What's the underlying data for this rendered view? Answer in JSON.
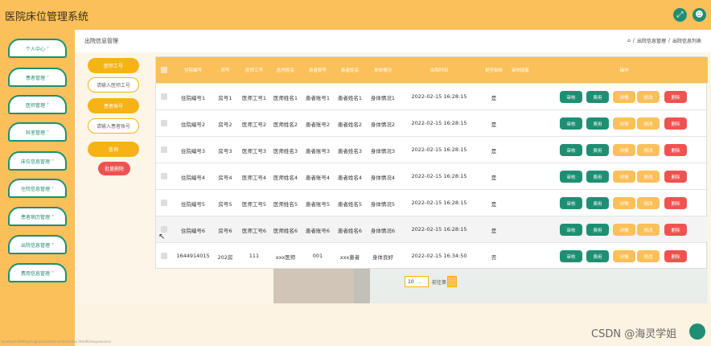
{
  "app": {
    "title": "医院床位管理系统",
    "icons": [
      "expand-icon",
      "user-icon"
    ]
  },
  "sidebar": {
    "items": [
      {
        "label": "个人中心 ˅"
      },
      {
        "label": "患者管理 ˅"
      },
      {
        "label": "医师管理 ˅"
      },
      {
        "label": "科室管理 ˅"
      },
      {
        "label": "床位信息管理 ˅"
      },
      {
        "label": "住院信息管理 ˅"
      },
      {
        "label": "患者病历管理 ˅"
      },
      {
        "label": "出院信息管理 ˅"
      },
      {
        "label": "费用信息管理 ˅"
      }
    ]
  },
  "header": {
    "page_title": "出院信息管理",
    "breadcrumb": [
      "⌂",
      "/",
      "出院信息管理",
      "/",
      "出院信息列表"
    ]
  },
  "search": {
    "doctor_label": "医师工号",
    "doctor_placeholder": "请输入医师工号",
    "patient_label": "患者账号",
    "patient_placeholder": "请输入患者账号",
    "query_button": "查询",
    "batch_delete_button": "批量删除"
  },
  "table": {
    "columns": [
      "住院编号",
      "房号",
      "医师工号",
      "医师姓名",
      "患者账号",
      "患者姓名",
      "身体情况",
      "出院时间",
      "是否审核",
      "审核回复",
      "操作"
    ],
    "rows": [
      [
        "住院编号1",
        "房号1",
        "医师工号1",
        "医师姓名1",
        "患者账号1",
        "患者姓名1",
        "身体情况1",
        "2022-02-15 16:28:15",
        "是",
        ""
      ],
      [
        "住院编号2",
        "房号2",
        "医师工号2",
        "医师姓名2",
        "患者账号2",
        "患者姓名2",
        "身体情况2",
        "2022-02-15 16:28:15",
        "是",
        ""
      ],
      [
        "住院编号3",
        "房号3",
        "医师工号3",
        "医师姓名3",
        "患者账号3",
        "患者姓名3",
        "身体情况3",
        "2022-02-15 16:28:15",
        "是",
        ""
      ],
      [
        "住院编号4",
        "房号4",
        "医师工号4",
        "医师姓名4",
        "患者账号4",
        "患者姓名4",
        "身体情况4",
        "2022-02-15 16:28:15",
        "是",
        ""
      ],
      [
        "住院编号5",
        "房号5",
        "医师工号5",
        "医师姓名5",
        "患者账号5",
        "患者姓名5",
        "身体情况5",
        "2022-02-15 16:28:15",
        "是",
        ""
      ],
      [
        "住院编号6",
        "房号6",
        "医师工号6",
        "医师姓名6",
        "患者账号6",
        "患者姓名6",
        "身体情况6",
        "2022-02-15 16:28:15",
        "是",
        ""
      ],
      [
        "1644914015",
        "202房",
        "111",
        "xxx医师",
        "001",
        "xxx患者",
        "身体良好",
        "2022-02-15 16:34:50",
        "否",
        ""
      ]
    ],
    "actions": [
      "审核",
      "费用",
      "详情",
      "修改",
      "删除"
    ]
  },
  "pagination": {
    "page_size": "10",
    "goto_label": "前往第"
  },
  "watermark": "CSDN @海灵学姐",
  "footer_url": "localhost:8080/springbootxxx/admin/dist/index.html#/chuyuanxinxi",
  "colors": {
    "primary_yellow": "#fbc05a",
    "accent_green": "#1f8f73",
    "danger_red": "#ef5350"
  }
}
